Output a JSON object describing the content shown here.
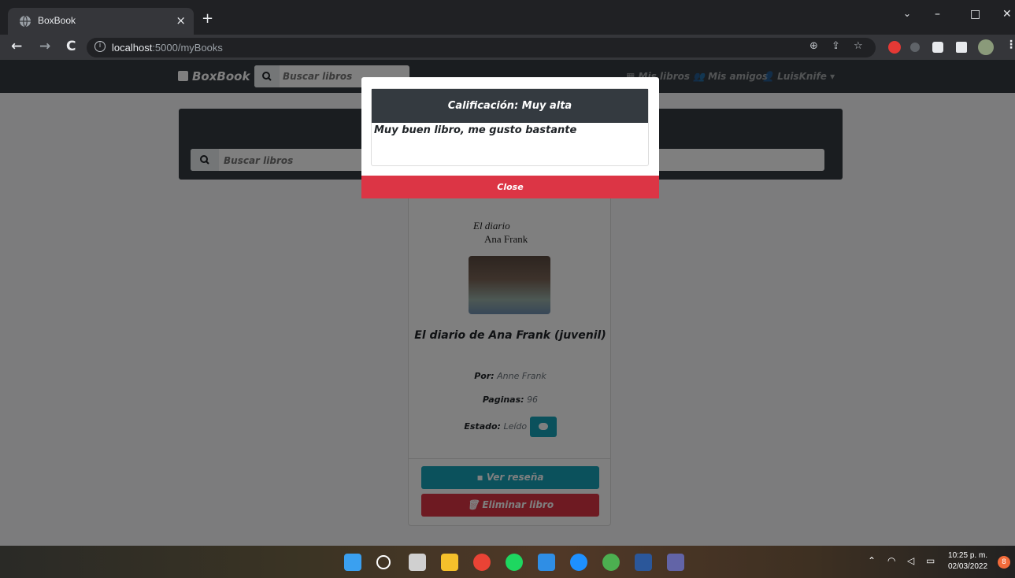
{
  "browser": {
    "tab_title": "BoxBook",
    "tab_close": "×",
    "new_tab": "+",
    "url_host": "localhost",
    "url_path": ":5000/myBooks",
    "win_min": "–",
    "win_max": "□",
    "win_close": "✕"
  },
  "navbar": {
    "brand": "BoxBook",
    "search_placeholder": "Buscar libros",
    "link_my_books": "Mis libros",
    "link_friends": "Mis amigos",
    "user": "LuisKnife"
  },
  "search": {
    "placeholder": "Buscar libros"
  },
  "book": {
    "cover_line1": "El diario",
    "cover_line2": "Ana Frank",
    "title": "El diario de Ana Frank (juvenil)",
    "author_label": "Por:",
    "author": "Anne Frank",
    "pages_label": "Paginas:",
    "pages": "96",
    "status_label": "Estado:",
    "status": "Leído",
    "review_button": "Ver reseña",
    "delete_button": "Eliminar libro"
  },
  "modal": {
    "title": "Calificación: Muy alta",
    "body": "Muy buen libro, me gusto bastante",
    "close": "Close"
  },
  "taskbar": {
    "time": "10:25 p. m.",
    "date": "02/03/2022",
    "notifications": "8"
  },
  "colors": {
    "dark": "#343a40",
    "info": "#17a2b8",
    "danger": "#dc3545"
  }
}
